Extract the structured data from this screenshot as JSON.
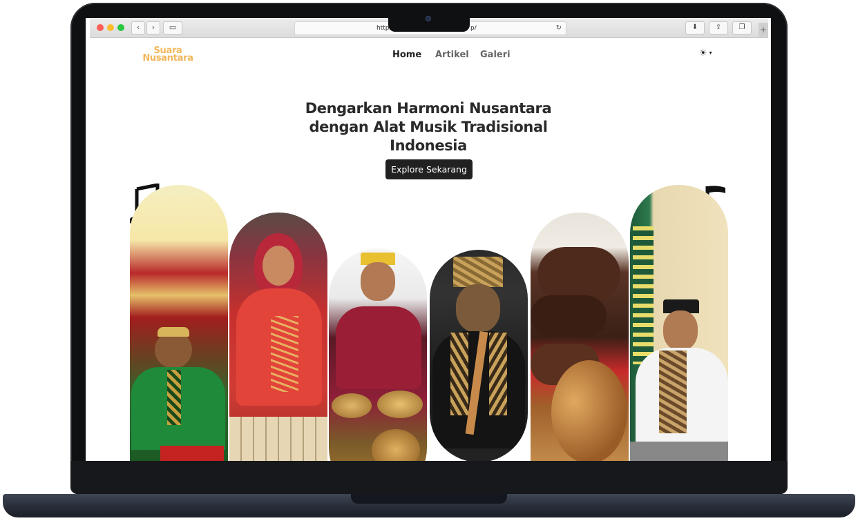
{
  "browser": {
    "url_left": "https",
    "url_right": "p/",
    "reload_icon": "↻",
    "back_icon": "‹",
    "forward_icon": "›",
    "sidebar_icon": "▭",
    "download_icon": "⬇",
    "share_icon": "⇪",
    "tabs_icon": "❐",
    "new_tab_icon": "+"
  },
  "site": {
    "logo_line1": "Suara",
    "logo_line2": "Nusantara",
    "nav": [
      "Home",
      "Artikel",
      "Galeri"
    ],
    "theme_icon": "☀",
    "theme_caret": "▾"
  },
  "hero": {
    "title_line1": "Dengarkan Harmoni Nusantara",
    "title_line2": "dengan Alat Musik Tradisional",
    "title_line3": "Indonesia",
    "cta": "Explore Sekarang"
  },
  "gallery": {
    "icons": [
      "music-note-icon",
      "music-note-icon"
    ],
    "images": [
      "gamelan-player-green",
      "saron-player-red",
      "bonang-player-maroon",
      "suling-player-black",
      "drum-hands",
      "boy-player-white"
    ]
  },
  "colors": {
    "logo": "#f2b75c",
    "cta_bg": "#212121",
    "title": "#2a2a2a"
  }
}
